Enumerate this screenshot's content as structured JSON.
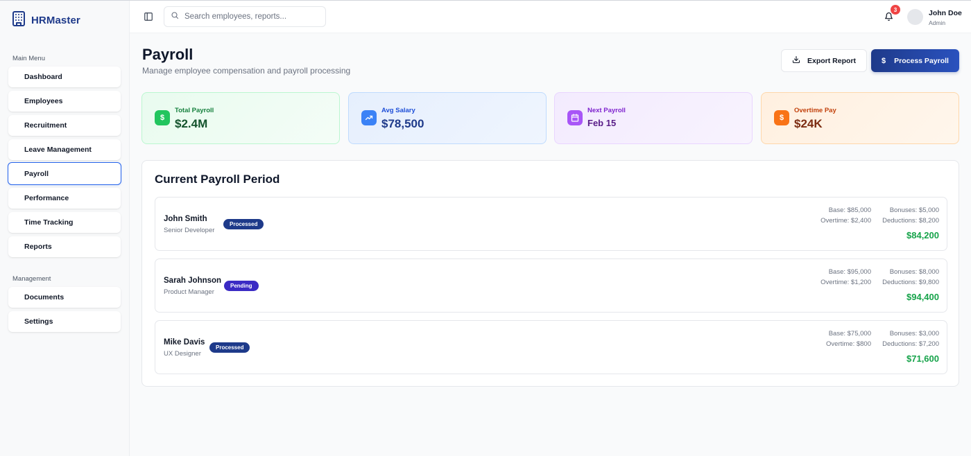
{
  "brand": {
    "name": "HRMaster",
    "color": "#1e3a8a"
  },
  "sidebar": {
    "main_menu_label": "Main Menu",
    "main_items": [
      {
        "label": "Dashboard",
        "active": false
      },
      {
        "label": "Employees",
        "active": false
      },
      {
        "label": "Recruitment",
        "active": false
      },
      {
        "label": "Leave Management",
        "active": false
      },
      {
        "label": "Payroll",
        "active": true
      },
      {
        "label": "Performance",
        "active": false
      },
      {
        "label": "Time Tracking",
        "active": false
      },
      {
        "label": "Reports",
        "active": false
      }
    ],
    "management_label": "Management",
    "management_items": [
      {
        "label": "Documents"
      },
      {
        "label": "Settings"
      }
    ]
  },
  "topbar": {
    "search_placeholder": "Search employees, reports...",
    "notification_count": "3",
    "user_name": "John Doe",
    "user_role": "Admin"
  },
  "header": {
    "title": "Payroll",
    "subtitle": "Manage employee compensation and payroll processing",
    "export_label": "Export Report",
    "process_label": "Process Payroll"
  },
  "stats": [
    {
      "label": "Total Payroll",
      "value": "$2.4M",
      "icon": "dollar-icon",
      "accent": "#22c55e",
      "label_color": "#15803d",
      "value_color": "#14532d",
      "bg": "#ecfdf3",
      "border": "#bbf7d0"
    },
    {
      "label": "Avg Salary",
      "value": "$78,500",
      "icon": "trending-up-icon",
      "accent": "#3b82f6",
      "label_color": "#1d4ed8",
      "value_color": "#1e3a8a",
      "bg": "#eaf2fe",
      "border": "#bfdbfe"
    },
    {
      "label": "Next Payroll",
      "value": "Feb 15",
      "icon": "calendar-icon",
      "accent": "#a855f7",
      "label_color": "#7e22ce",
      "value_color": "#581c87",
      "bg": "#f5effe",
      "border": "#e9d5ff"
    },
    {
      "label": "Overtime Pay",
      "value": "$24K",
      "icon": "dollar-icon",
      "accent": "#f97316",
      "label_color": "#c2410c",
      "value_color": "#7c2d12",
      "bg": "#fff3e6",
      "border": "#fed7aa"
    }
  ],
  "payroll": {
    "title": "Current Payroll Period",
    "employees": [
      {
        "name": "John Smith",
        "role": "Senior Developer",
        "status": "Processed",
        "base": "Base: $85,000",
        "bonuses": "Bonuses: $5,000",
        "overtime": "Overtime: $2,400",
        "deductions": "Deductions: $8,200",
        "net": "$84,200"
      },
      {
        "name": "Sarah Johnson",
        "role": "Product Manager",
        "status": "Pending",
        "base": "Base: $95,000",
        "bonuses": "Bonuses: $8,000",
        "overtime": "Overtime: $1,200",
        "deductions": "Deductions: $9,800",
        "net": "$94,400"
      },
      {
        "name": "Mike Davis",
        "role": "UX Designer",
        "status": "Processed",
        "base": "Base: $75,000",
        "bonuses": "Bonuses: $3,000",
        "overtime": "Overtime: $800",
        "deductions": "Deductions: $7,200",
        "net": "$71,600"
      }
    ]
  }
}
